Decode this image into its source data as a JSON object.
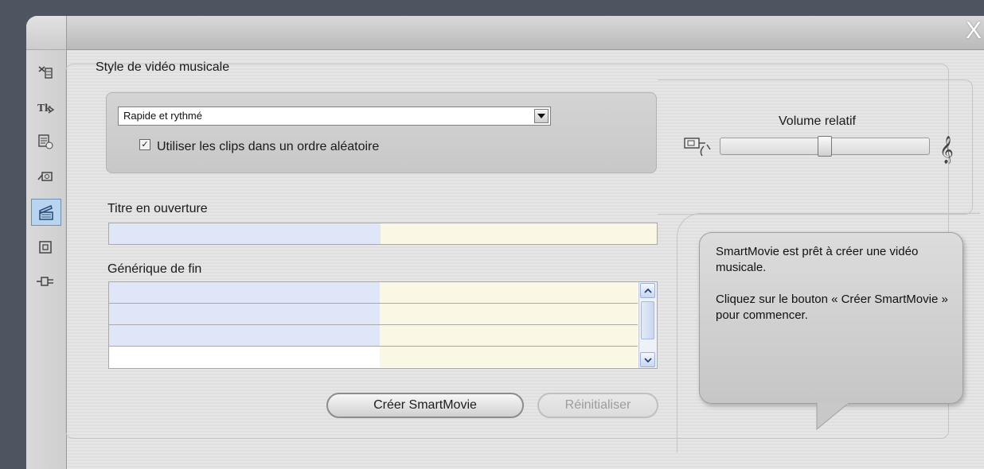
{
  "window": {
    "close_label": "X"
  },
  "sidebar": {
    "items": [
      {
        "icon": "edit-icon"
      },
      {
        "icon": "title-icon"
      },
      {
        "icon": "menu-icon"
      },
      {
        "icon": "camera-icon"
      },
      {
        "icon": "smartmovie-icon",
        "active": true
      },
      {
        "icon": "frame-icon"
      },
      {
        "icon": "plugin-icon"
      }
    ]
  },
  "music_video": {
    "section_label": "Style de vidéo musicale",
    "style_select": {
      "value": "Rapide et rythmé"
    },
    "random_order": {
      "checked": true,
      "label": "Utiliser les clips dans un ordre aléatoire"
    },
    "opening_title": {
      "label": "Titre en ouverture",
      "value_left": "",
      "value_right": ""
    },
    "end_credits": {
      "label": "Générique de fin",
      "rows": [
        {
          "left": "",
          "right": ""
        },
        {
          "left": "",
          "right": ""
        },
        {
          "left": "",
          "right": ""
        }
      ]
    },
    "buttons": {
      "create": "Créer SmartMovie",
      "reset": "Réinitialiser"
    }
  },
  "volume": {
    "label": "Volume relatif",
    "level": 0.5
  },
  "help": {
    "line1": "SmartMovie est prêt à créer une vidéo musicale.",
    "line2": "Cliquez sur le bouton « Créer SmartMovie » pour commencer."
  },
  "colors": {
    "active_tab": "#b9d4ee",
    "field_left": "#dfe6f8",
    "field_right": "#faf7e4"
  }
}
